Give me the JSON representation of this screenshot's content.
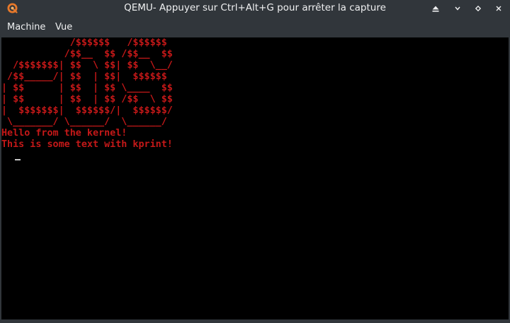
{
  "window": {
    "title": "QEMU- Appuyer sur Ctrl+Alt+G pour arrêter la capture",
    "app_icon": "qemu-logo-icon",
    "controls": {
      "shade_icon": "shade-up-icon",
      "minimize_icon": "minimize-icon",
      "maximize_icon": "maximize-icon",
      "close_icon": "close-icon"
    }
  },
  "menubar": {
    "items": [
      {
        "label": "Machine"
      },
      {
        "label": "Vue"
      }
    ]
  },
  "console": {
    "text_color": "#c41818",
    "background": "#000000",
    "ascii_logo": [
      "            /$$$$$$   /$$$$$$ ",
      "           /$$__  $$ /$$__  $$",
      "  /$$$$$$$| $$  \\ $$| $$  \\__/",
      " /$$_____/| $$  | $$|  $$$$$$ ",
      "| $$      | $$  | $$ \\____  $$",
      "| $$      | $$  | $$ /$$  \\ $$",
      "|  $$$$$$$|  $$$$$$/|  $$$$$$/",
      " \\_______/ \\______/  \\______/ "
    ],
    "messages": [
      "Hello from the kernel!",
      "This is some text with kprint!"
    ],
    "cursor_glyph": "_"
  }
}
